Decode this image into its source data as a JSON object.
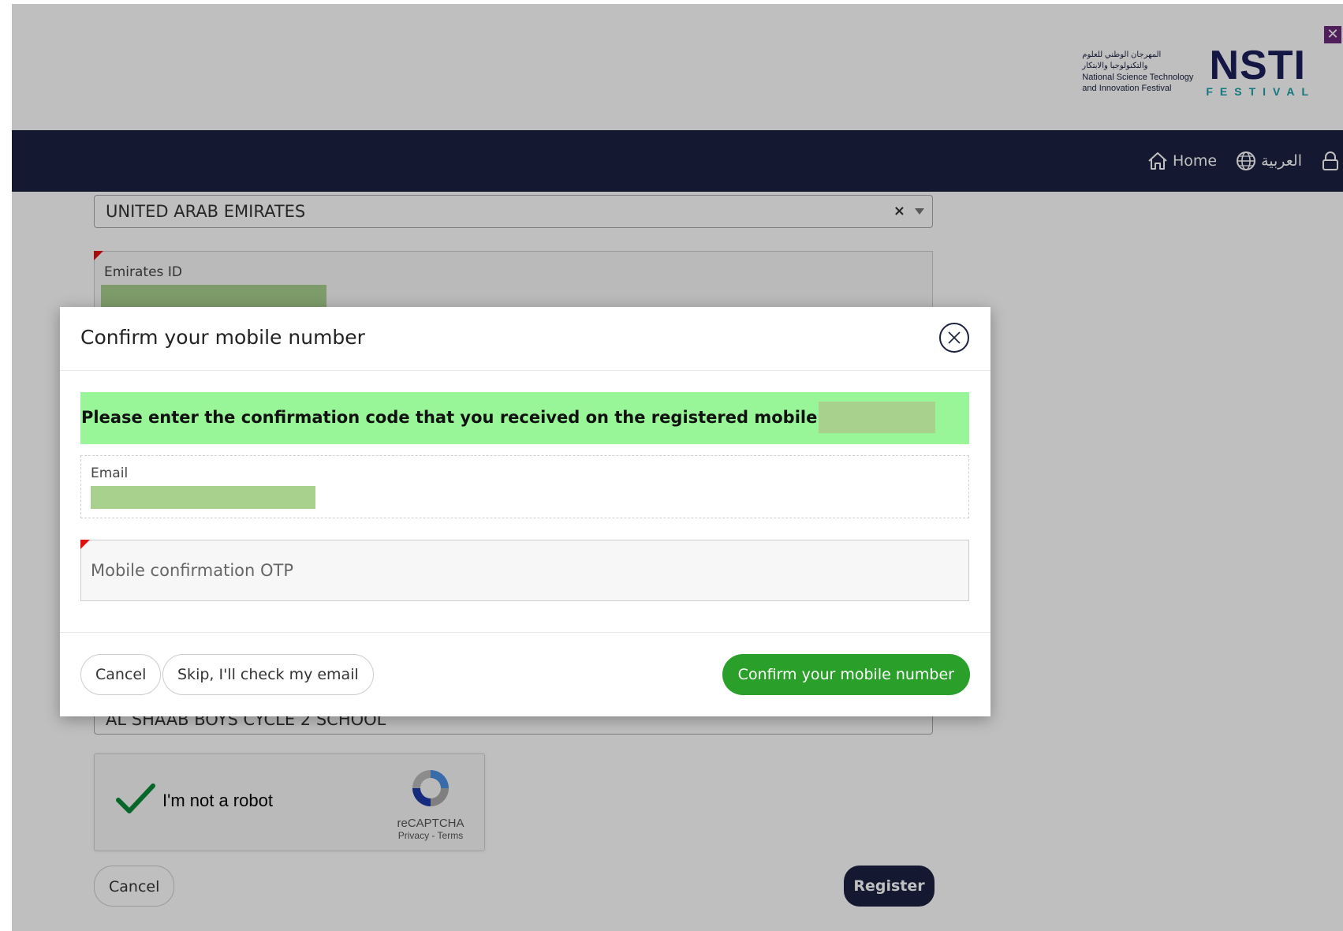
{
  "header": {
    "logo_arabic_1": "المهرجان الوطني للعلوم",
    "logo_arabic_2": "والتكنولوجيا والابتكار",
    "logo_en_1": "National Science Technology",
    "logo_en_2": "and Innovation Festival",
    "logo_nsti": "NSTI",
    "logo_festival": "FESTIVAL"
  },
  "nav": {
    "home_label": "Home",
    "arabic_label": "العربية"
  },
  "form": {
    "country_value": "UNITED ARAB EMIRATES",
    "emirates_id_label": "Emirates ID",
    "school_value": "AL SHAAB BOYS CYCLE 2 SCHOOL",
    "recaptcha_label": "I'm not a robot",
    "recaptcha_brand": "reCAPTCHA",
    "recaptcha_links": "Privacy - Terms",
    "cancel_label": "Cancel",
    "register_label": "Register"
  },
  "modal": {
    "title": "Confirm your mobile number",
    "notice_text": "Please enter the confirmation code that you received on the registered mobile number",
    "email_label": "Email",
    "otp_placeholder": "Mobile confirmation OTP",
    "cancel_label": "Cancel",
    "skip_label": "Skip, I'll check my email",
    "confirm_label": "Confirm your mobile number"
  },
  "colors": {
    "navbar": "#1b2140",
    "notice_bg": "#98f598",
    "confirm_button": "#2aa02a",
    "required_marker": "#e01010",
    "redaction": "#a9d18e"
  },
  "icons": [
    "close-corner-icon",
    "home-icon",
    "globe-icon",
    "lock-user-icon",
    "close-icon",
    "checkmark-icon",
    "recaptcha-logo-icon"
  ]
}
